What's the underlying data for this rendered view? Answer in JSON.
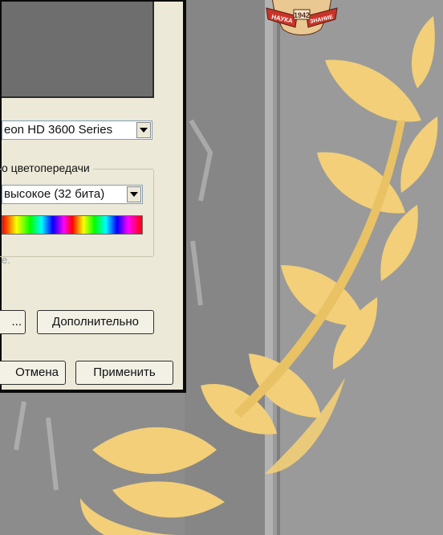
{
  "display_settings_dialog": {
    "adapter": {
      "value": "eon HD 3600 Series"
    },
    "color_quality": {
      "group_label": "о цветопередачи",
      "value": "высокое (32 бита)",
      "hint": "e."
    },
    "buttons": {
      "troubleshoot": "...",
      "advanced": "Дополнительно",
      "cancel": "Отмена",
      "apply": "Применить"
    }
  },
  "emblem": {
    "left_ribbon": "НАУКА",
    "year": "1942",
    "right_ribbon": "ЗНАНИЕ"
  },
  "colors": {
    "dialog_bg": "#ece9d8",
    "laurel": "#f2cf78",
    "background": "#8d8d8d",
    "emblem_red": "#c9342a"
  }
}
